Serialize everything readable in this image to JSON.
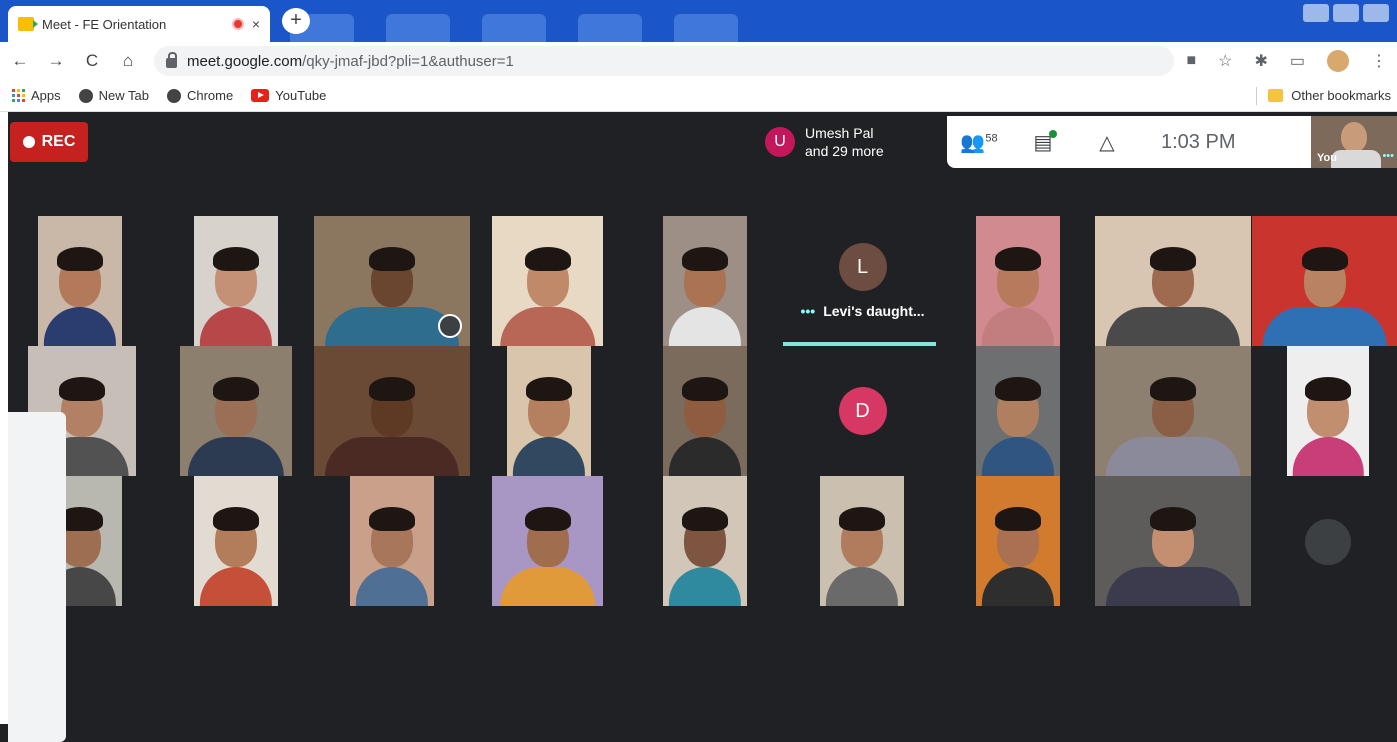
{
  "browser": {
    "tab_title": "Meet - FE Orientation",
    "tab_close": "×",
    "new_tab": "+",
    "url_host": "meet.google.com",
    "url_rest": "/qky-jmaf-jbd?pli=1&authuser=1",
    "bookmarks": [
      "Apps",
      "New Tab",
      "Chrome",
      "YouTube"
    ],
    "other_bookmarks": "Other bookmarks",
    "nav": {
      "back": "←",
      "forward": "→",
      "reload": "C",
      "home": "⌂"
    },
    "right_icons": {
      "camera": "■",
      "star": "☆",
      "extensions": "✱",
      "cast": "▭",
      "menu": "⋮"
    }
  },
  "meet": {
    "rec_label": "REC",
    "speaker": {
      "initial": "U",
      "line1": "Umesh Pal",
      "line2": "and 29 more"
    },
    "people_icon": "👥",
    "people_count": "58",
    "chat_icon": "▤",
    "activities_icon": "△",
    "time": "1:03 PM",
    "self_label": "You",
    "self_dots": "•••",
    "avatar_tiles": [
      {
        "initial": "L",
        "name": "Levi's daught...",
        "dots": "•••",
        "color": "#6d4c41"
      },
      {
        "initial": "D",
        "color": "#d63863"
      }
    ]
  },
  "colors": {
    "chrome_blue": "#1a56c8",
    "meet_bg": "#202124",
    "rec_red": "#c5221f",
    "speaking": "#81e6d9"
  }
}
